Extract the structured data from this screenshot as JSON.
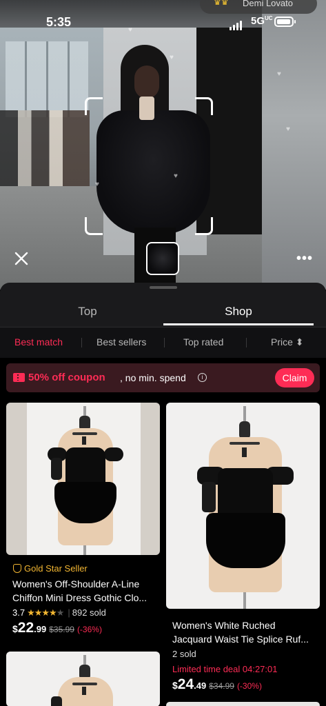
{
  "status_bar": {
    "time": "5:35",
    "network": "5G",
    "network_sub": "UC"
  },
  "live_pill": {
    "name": "Demi Lovato"
  },
  "camera": {
    "more_label": "•••"
  },
  "tabs": [
    {
      "label": "Top"
    },
    {
      "label": "Shop"
    }
  ],
  "filters": [
    {
      "label": "Best match"
    },
    {
      "label": "Best sellers"
    },
    {
      "label": "Top rated"
    },
    {
      "label": "Price ⬍"
    }
  ],
  "coupon": {
    "title": "50% off coupon",
    "subtitle": ", no min. spend",
    "info_glyph": "i",
    "claim_label": "Claim"
  },
  "products": [
    {
      "badge": "Gold Star Seller",
      "title_line1": "Women's Off-Shoulder A-Line",
      "title_line2": "Chiffon Mini Dress Gothic Clo...",
      "rating": "3.7",
      "rating_value": 3.7,
      "sold": "892 sold",
      "price_currency": "$",
      "price_int": "22",
      "price_dec": ".99",
      "orig_price": "$35.99",
      "discount": "(-36%)"
    },
    {
      "title_line1": "Women's White Ruched",
      "title_line2": "Jacquard Waist Tie Splice Ruf...",
      "sold": "2 sold",
      "deal": "Limited time deal 04:27:01",
      "price_currency": "$",
      "price_int": "24",
      "price_dec": ".49",
      "orig_price": "$34.99",
      "discount": "(-30%)"
    }
  ],
  "colors": {
    "accent": "#fe2c55",
    "gold": "#f2b632",
    "sheet_bg": "#1a1a1c"
  }
}
